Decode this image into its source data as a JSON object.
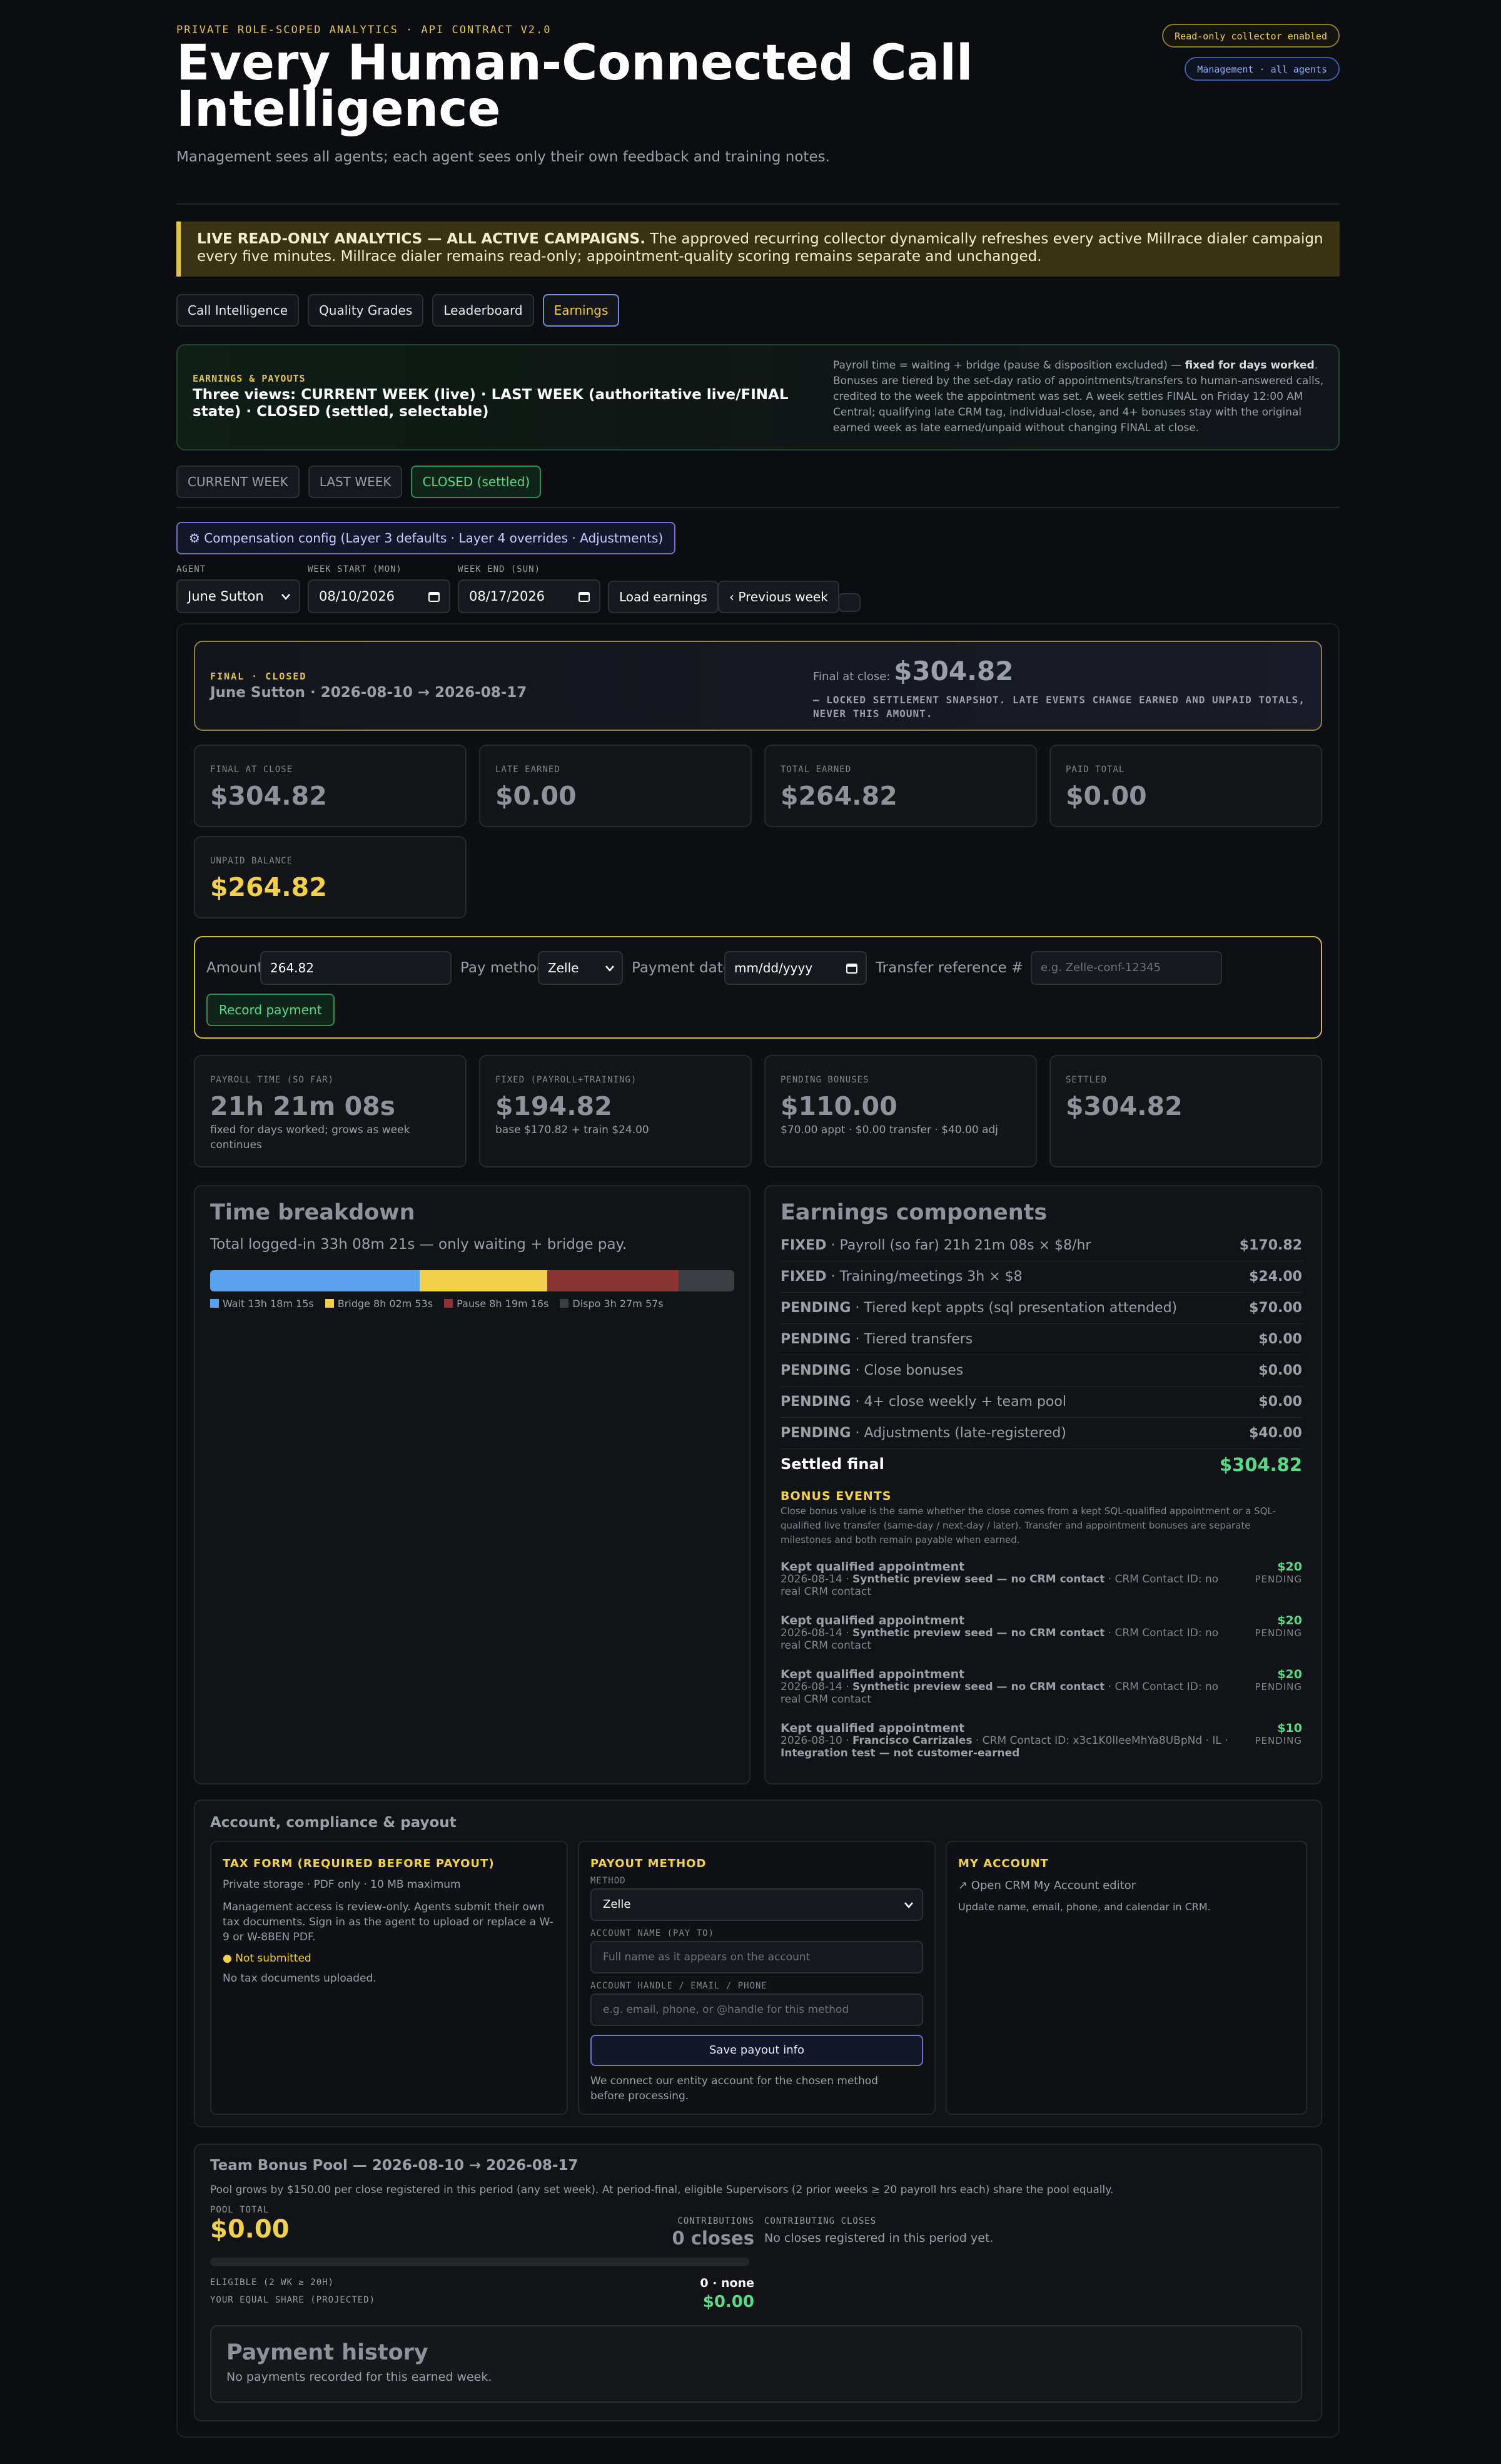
{
  "header": {
    "eyebrow": "PRIVATE ROLE-SCOPED ANALYTICS · API CONTRACT V2.0",
    "title": "Every Human-Connected Call Intelligence",
    "subtitle": "Management sees all agents; each agent sees only their own feedback and training notes.",
    "pill_readonly": "Read-only collector enabled",
    "pill_management": "Management · all agents"
  },
  "banner": {
    "strong": "LIVE READ-ONLY ANALYTICS — ALL ACTIVE CAMPAIGNS.",
    "text": " The approved recurring collector dynamically refreshes every active Millrace dialer campaign every five minutes. Millrace dialer remains read-only; appointment-quality scoring remains separate and unchanged."
  },
  "tabs": [
    "Call Intelligence",
    "Quality Grades",
    "Leaderboard",
    "Earnings"
  ],
  "active_tab": "Earnings",
  "earnings_header": {
    "label": "EARNINGS & PAYOUTS",
    "views": "Three views: CURRENT WEEK (live) · LAST WEEK (authoritative live/FINAL state) · CLOSED (settled, selectable)",
    "note_pre": "Payroll time = waiting + bridge (pause & disposition excluded) — ",
    "note_strong": "fixed for days worked",
    "note_post": ". Bonuses are tiered by the set-day ratio of appointments/transfers to human-answered calls, credited to the week the appointment was set. A week settles FINAL on Friday 12:00 AM Central; qualifying late CRM tag, individual-close, and 4+ bonuses stay with the original earned week as late earned/unpaid without changing FINAL at close."
  },
  "view_tabs": [
    "CURRENT WEEK",
    "LAST WEEK",
    "CLOSED (settled)"
  ],
  "comp_button": "⚙ Compensation config (Layer 3 defaults · Layer 4 overrides · Adjustments)",
  "filters": {
    "agent_label": "AGENT",
    "agent_value": "June Sutton",
    "week_start_label": "WEEK START (MON)",
    "week_start_value": "08/10/2026",
    "week_end_label": "WEEK END (SUN)",
    "week_end_value": "08/17/2026",
    "load_button": "Load earnings",
    "prev_button": "‹ Previous week"
  },
  "final_card": {
    "tag": "FINAL · CLOSED",
    "who": "June Sutton · 2026-08-10 → 2026-08-17",
    "final_label": "Final at close:",
    "final_value": "$304.82",
    "locked": "— LOCKED SETTLEMENT SNAPSHOT. LATE EVENTS CHANGE EARNED AND UNPAID TOTALS, NEVER THIS AMOUNT."
  },
  "stats": [
    {
      "label": "FINAL AT CLOSE",
      "value": "$304.82"
    },
    {
      "label": "LATE EARNED",
      "value": "$0.00"
    },
    {
      "label": "TOTAL EARNED",
      "value": "$264.82"
    },
    {
      "label": "PAID TOTAL",
      "value": "$0.00"
    },
    {
      "label": "UNPAID BALANCE",
      "value": "$264.82"
    }
  ],
  "payment_form": {
    "amount_label": "Amount",
    "amount_value": "264.82",
    "method_label": "Pay method",
    "method_value": "Zelle",
    "date_label": "Payment date",
    "date_placeholder": "mm/dd/yyyy",
    "ref_label": "Transfer reference #",
    "ref_placeholder": "e.g. Zelle-conf-12345",
    "record_button": "Record payment"
  },
  "stats2": [
    {
      "label": "PAYROLL TIME (SO FAR)",
      "value": "21h 21m 08s",
      "sub": "fixed for days worked; grows as week continues"
    },
    {
      "label": "FIXED (PAYROLL+TRAINING)",
      "value": "$194.82",
      "sub": "base $170.82 + train $24.00"
    },
    {
      "label": "PENDING BONUSES",
      "value": "$110.00",
      "sub": "$70.00 appt · $0.00 transfer · $40.00 adj"
    },
    {
      "label": "SETTLED",
      "value": "$304.82",
      "sub": ""
    }
  ],
  "time_breakdown": {
    "title": "Time breakdown",
    "subtitle": "Total logged-in 33h 08m 21s — only waiting + bridge pay.",
    "segments": [
      {
        "name": "Wait 13h 18m 15s",
        "fraction": 0.4,
        "color": "#5aa2f0"
      },
      {
        "name": "Bridge 8h 02m 53s",
        "fraction": 0.243,
        "color": "#f2d04a"
      },
      {
        "name": "Pause 8h 19m 16s",
        "fraction": 0.251,
        "color": "#8c3434"
      },
      {
        "name": "Dispo 3h 27m 57s",
        "fraction": 0.106,
        "color": "#3a3d42"
      }
    ]
  },
  "components": {
    "title": "Earnings components",
    "rows": [
      {
        "tag": "FIXED",
        "desc": " · Payroll (so far) 21h 21m 08s × $8/hr",
        "amount": "$170.82"
      },
      {
        "tag": "FIXED",
        "desc": " · Training/meetings 3h × $8",
        "amount": "$24.00"
      },
      {
        "tag": "PENDING",
        "desc": " · Tiered kept appts (sql presentation attended)",
        "amount": "$70.00"
      },
      {
        "tag": "PENDING",
        "desc": " · Tiered transfers",
        "amount": "$0.00"
      },
      {
        "tag": "PENDING",
        "desc": " · Close bonuses",
        "amount": "$0.00"
      },
      {
        "tag": "PENDING",
        "desc": " · 4+ close weekly + team pool",
        "amount": "$0.00"
      },
      {
        "tag": "PENDING",
        "desc": " · Adjustments (late-registered)",
        "amount": "$40.00"
      }
    ],
    "settled_label": "Settled final",
    "settled_value": "$304.82",
    "bonus_title": "BONUS EVENTS",
    "bonus_desc": "Close bonus value is the same whether the close comes from a kept SQL-qualified appointment or a SQL-qualified live transfer (same-day / next-day / later). Transfer and appointment bonuses are separate milestones and both remain payable when earned.",
    "events": [
      {
        "title": "Kept qualified appointment",
        "date": "2026-08-14 · ",
        "strong": "Synthetic preview seed — no CRM contact",
        "rest": " · CRM Contact ID: no real CRM contact",
        "extra": "",
        "amount": "$20",
        "status": "PENDING"
      },
      {
        "title": "Kept qualified appointment",
        "date": "2026-08-14 · ",
        "strong": "Synthetic preview seed — no CRM contact",
        "rest": " · CRM Contact ID: no real CRM contact",
        "extra": "",
        "amount": "$20",
        "status": "PENDING"
      },
      {
        "title": "Kept qualified appointment",
        "date": "2026-08-14 · ",
        "strong": "Synthetic preview seed — no CRM contact",
        "rest": " · CRM Contact ID: no real CRM contact",
        "extra": "",
        "amount": "$20",
        "status": "PENDING"
      },
      {
        "title": "Kept qualified appointment",
        "date": "2026-08-10 · ",
        "strong": "Francisco Carrizales",
        "rest": " · CRM Contact ID: x3c1K0lIeeMhYa8UBpNd · IL ·",
        "extra": "Integration test — not customer-earned",
        "amount": "$10",
        "status": "PENDING"
      }
    ]
  },
  "account": {
    "title": "Account, compliance & payout",
    "tax": {
      "heading": "TAX FORM (REQUIRED BEFORE PAYOUT)",
      "storage": "Private storage · PDF only · 10 MB maximum",
      "desc": "Management access is review-only. Agents submit their own tax documents. Sign in as the agent to upload or replace a W-9 or W-8BEN PDF.",
      "status": "● Not submitted",
      "none": "No tax documents uploaded."
    },
    "payout": {
      "heading": "PAYOUT METHOD",
      "method_label": "METHOD",
      "method_value": "Zelle",
      "name_label": "ACCOUNT NAME (PAY TO)",
      "name_placeholder": "Full name as it appears on the account",
      "handle_label": "ACCOUNT HANDLE / EMAIL / PHONE",
      "handle_placeholder": "e.g. email, phone, or @handle for this method",
      "save": "Save payout info",
      "note": "We connect our entity account for the chosen method before processing."
    },
    "my": {
      "heading": "MY ACCOUNT",
      "link": "↗ Open CRM My Account editor",
      "desc": "Update name, email, phone, and calendar in CRM."
    }
  },
  "pool": {
    "title": "Team Bonus Pool — 2026-08-10 → 2026-08-17",
    "desc": "Pool grows by $150.00 per close registered in this period (any set week). At period-final, eligible Supervisors (2 prior weeks ≥ 20 payroll hrs each) share the pool equally.",
    "total_label": "POOL TOTAL",
    "total_value": "$0.00",
    "contrib_label": "CONTRIBUTIONS",
    "contrib_value": "0 closes",
    "closes_label": "CONTRIBUTING CLOSES",
    "closes_value": "No closes registered in this period yet.",
    "eligible_label": "ELIGIBLE (2 WK ≥ 20H)",
    "eligible_value": "0 · none",
    "share_label": "YOUR EQUAL SHARE (PROJECTED)",
    "share_value": "$0.00"
  },
  "history": {
    "title": "Payment history",
    "empty": "No payments recorded for this earned week."
  }
}
